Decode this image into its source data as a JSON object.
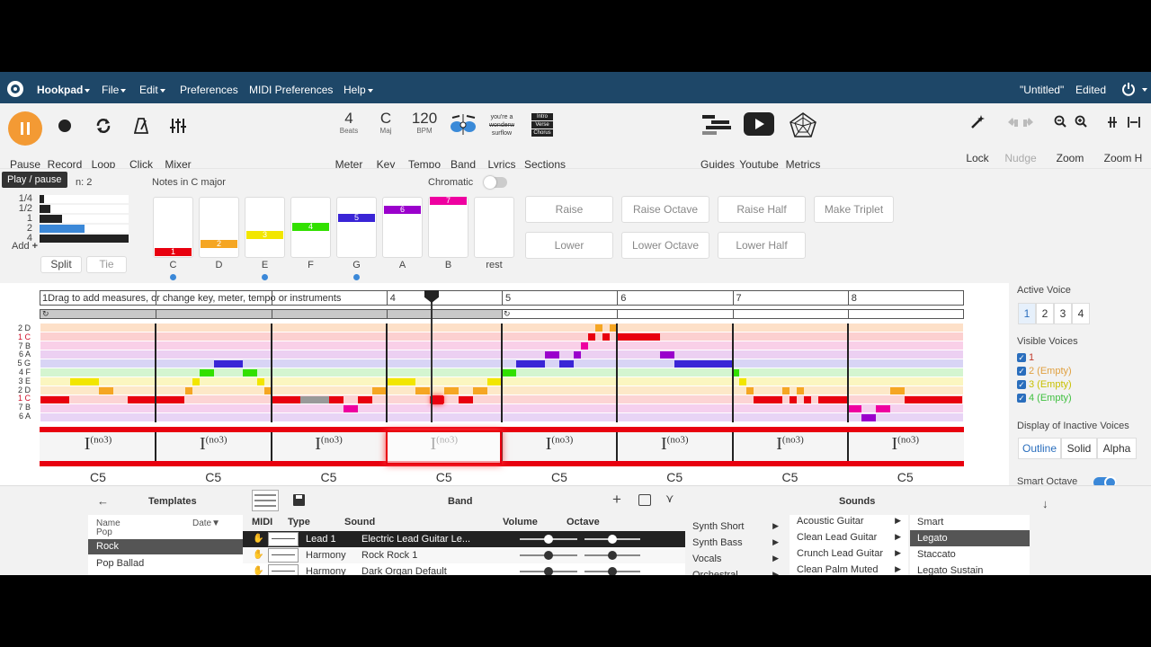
{
  "menubar": {
    "app": "Hookpad",
    "items": [
      "File",
      "Edit",
      "Preferences",
      "MIDI Preferences",
      "Help"
    ],
    "title": "\"Untitled\"",
    "status": "Edited"
  },
  "toolbar": {
    "pause": "Pause",
    "record": "Record",
    "loop": "Loop",
    "click": "Click",
    "mixer": "Mixer",
    "meter_value": "4",
    "meter_sub": "Beats",
    "meter": "Meter",
    "key_value": "C",
    "key_sub": "Maj",
    "key": "Key",
    "tempo_value": "120",
    "tempo_sub": "BPM",
    "tempo": "Tempo",
    "band": "Band",
    "lyrics_art": [
      "you're a",
      "wonderw",
      "surflow"
    ],
    "lyrics": "Lyrics",
    "sections_art": [
      "Intro",
      "Verse",
      "Chorus"
    ],
    "sections": "Sections",
    "guides": "Guides",
    "youtube": "Youtube",
    "metrics": "Metrics",
    "lock": "Lock",
    "nudge": "Nudge",
    "zoom": "Zoom",
    "zoomh": "Zoom H",
    "tooltip": "Play / pause"
  },
  "notes_panel": {
    "duration_label": "n: 2",
    "durations": [
      "1/4",
      "1/2",
      "1",
      "2",
      "4"
    ],
    "duration_fill": [
      0.05,
      0.12,
      0.25,
      0.5,
      1.0
    ],
    "add": "Add",
    "split": "Split",
    "tie": "Tie",
    "notes_in": "Notes in C major",
    "chromatic": "Chromatic",
    "keys": [
      {
        "name": "C",
        "num": "1",
        "color": "#e8000f",
        "level": 0,
        "dot": true
      },
      {
        "name": "D",
        "num": "2",
        "color": "#f5a623",
        "level": 1,
        "dot": false
      },
      {
        "name": "E",
        "num": "3",
        "color": "#f2e600",
        "level": 2,
        "dot": true
      },
      {
        "name": "F",
        "num": "4",
        "color": "#32e000",
        "level": 3,
        "dot": false
      },
      {
        "name": "G",
        "num": "5",
        "color": "#3a25d6",
        "level": 4,
        "dot": true
      },
      {
        "name": "A",
        "num": "6",
        "color": "#9a00cc",
        "level": 5,
        "dot": false
      },
      {
        "name": "B",
        "num": "7",
        "color": "#ee00a0",
        "level": 6,
        "dot": false
      },
      {
        "name": "rest",
        "num": "",
        "color": "",
        "level": -1,
        "dot": false
      }
    ],
    "actions": [
      "Raise",
      "Raise Octave",
      "Raise Half",
      "Make Triplet",
      "Lower",
      "Lower Octave",
      "Lower Half"
    ]
  },
  "editor": {
    "hint": "1Drag to add measures, or change key, meter, tempo or instruments",
    "measures": [
      "",
      "",
      "",
      "4",
      "5",
      "6",
      "7",
      "8"
    ],
    "row_labels": [
      "2 D",
      "1 C",
      "7 B",
      "6 A",
      "5 G",
      "4 F",
      "3 E",
      "2 D",
      "1 C",
      "7 B",
      "6 A"
    ],
    "chords": [
      "I",
      "I",
      "I",
      "I",
      "I",
      "I",
      "I",
      "I"
    ],
    "chord_ext": "(no3)",
    "chord_names": [
      "C5",
      "C5",
      "C5",
      "C5",
      "C5",
      "C5",
      "C5",
      "C5"
    ]
  },
  "right_panel": {
    "active_voice": "Active Voice",
    "voices": [
      "1",
      "2",
      "3",
      "4"
    ],
    "visible_voices": "Visible Voices",
    "visible": [
      {
        "label": "1",
        "color": "#c0392b"
      },
      {
        "label": "2 (Empty)",
        "color": "#e0a040"
      },
      {
        "label": "3 (Empty)",
        "color": "#c8c000"
      },
      {
        "label": "4 (Empty)",
        "color": "#40c040"
      }
    ],
    "inactive": "Display of Inactive Voices",
    "modes": [
      "Outline",
      "Solid",
      "Alpha"
    ],
    "smart_octave": "Smart Octave"
  },
  "bottom": {
    "templates": "Templates",
    "col_name": "Name",
    "col_date": "Date",
    "template_items": [
      "Pop",
      "Rock",
      "Pop Ballad"
    ],
    "band": "Band",
    "band_cols": [
      "MIDI",
      "Type",
      "Sound",
      "Volume",
      "Octave"
    ],
    "band_rows": [
      {
        "type": "Lead 1",
        "sound": "Electric Lead Guitar Le..."
      },
      {
        "type": "Harmony",
        "sound": "Rock Rock 1"
      },
      {
        "type": "Harmony",
        "sound": "Dark Organ Default"
      }
    ],
    "sounds": "Sounds",
    "categories": [
      "Synth Short",
      "Synth Bass",
      "Vocals",
      "Orchestral"
    ],
    "instruments": [
      "Acoustic Guitar",
      "Clean Lead Guitar",
      "Crunch Lead Guitar",
      "Clean Palm Muted"
    ],
    "articulations": [
      "Smart",
      "Legato",
      "Staccato",
      "Legato Sustain"
    ]
  }
}
